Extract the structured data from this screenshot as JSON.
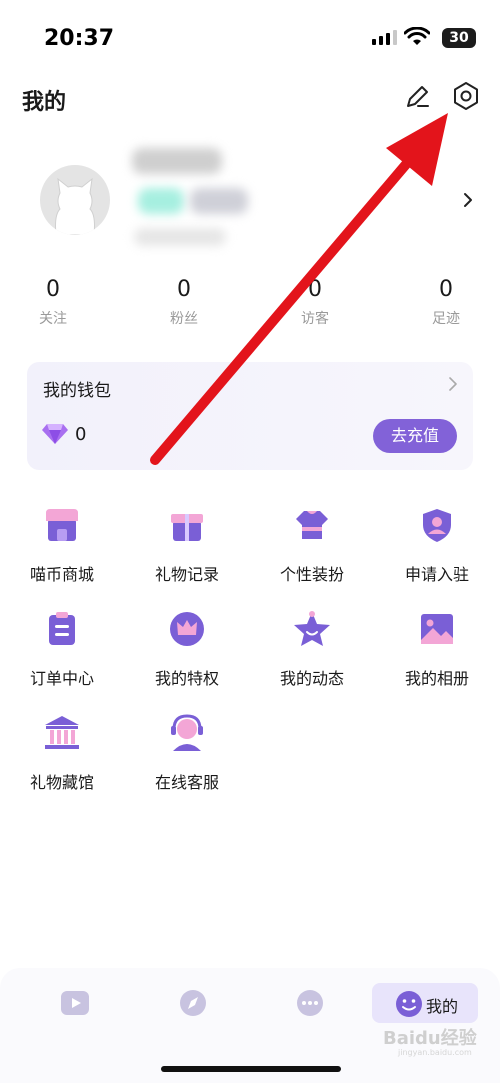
{
  "status_bar": {
    "time": "20:37",
    "battery": "30"
  },
  "header": {
    "title": "我的"
  },
  "stats": [
    {
      "value": "0",
      "label": "关注"
    },
    {
      "value": "0",
      "label": "粉丝"
    },
    {
      "value": "0",
      "label": "访客"
    },
    {
      "value": "0",
      "label": "足迹"
    }
  ],
  "wallet": {
    "title": "我的钱包",
    "amount": "0",
    "recharge_label": "去充值"
  },
  "menu": [
    {
      "label": "喵币商城",
      "icon": "shop-icon"
    },
    {
      "label": "礼物记录",
      "icon": "gift-icon"
    },
    {
      "label": "个性装扮",
      "icon": "shirt-icon"
    },
    {
      "label": "申请入驻",
      "icon": "shield-user-icon"
    },
    {
      "label": "订单中心",
      "icon": "clipboard-icon"
    },
    {
      "label": "我的特权",
      "icon": "crown-icon"
    },
    {
      "label": "我的动态",
      "icon": "star-icon"
    },
    {
      "label": "我的相册",
      "icon": "image-icon"
    },
    {
      "label": "礼物藏馆",
      "icon": "museum-icon"
    },
    {
      "label": "在线客服",
      "icon": "headset-icon"
    }
  ],
  "tabbar": {
    "active_label": "我的"
  },
  "watermark": {
    "text": "Baidu经验",
    "sub": "jingyan.baidu.com"
  },
  "colors": {
    "accent": "#8262d8",
    "icon_purple": "#7a5fd6",
    "icon_pink": "#f3a6d6",
    "arrow": "#e3141b"
  }
}
